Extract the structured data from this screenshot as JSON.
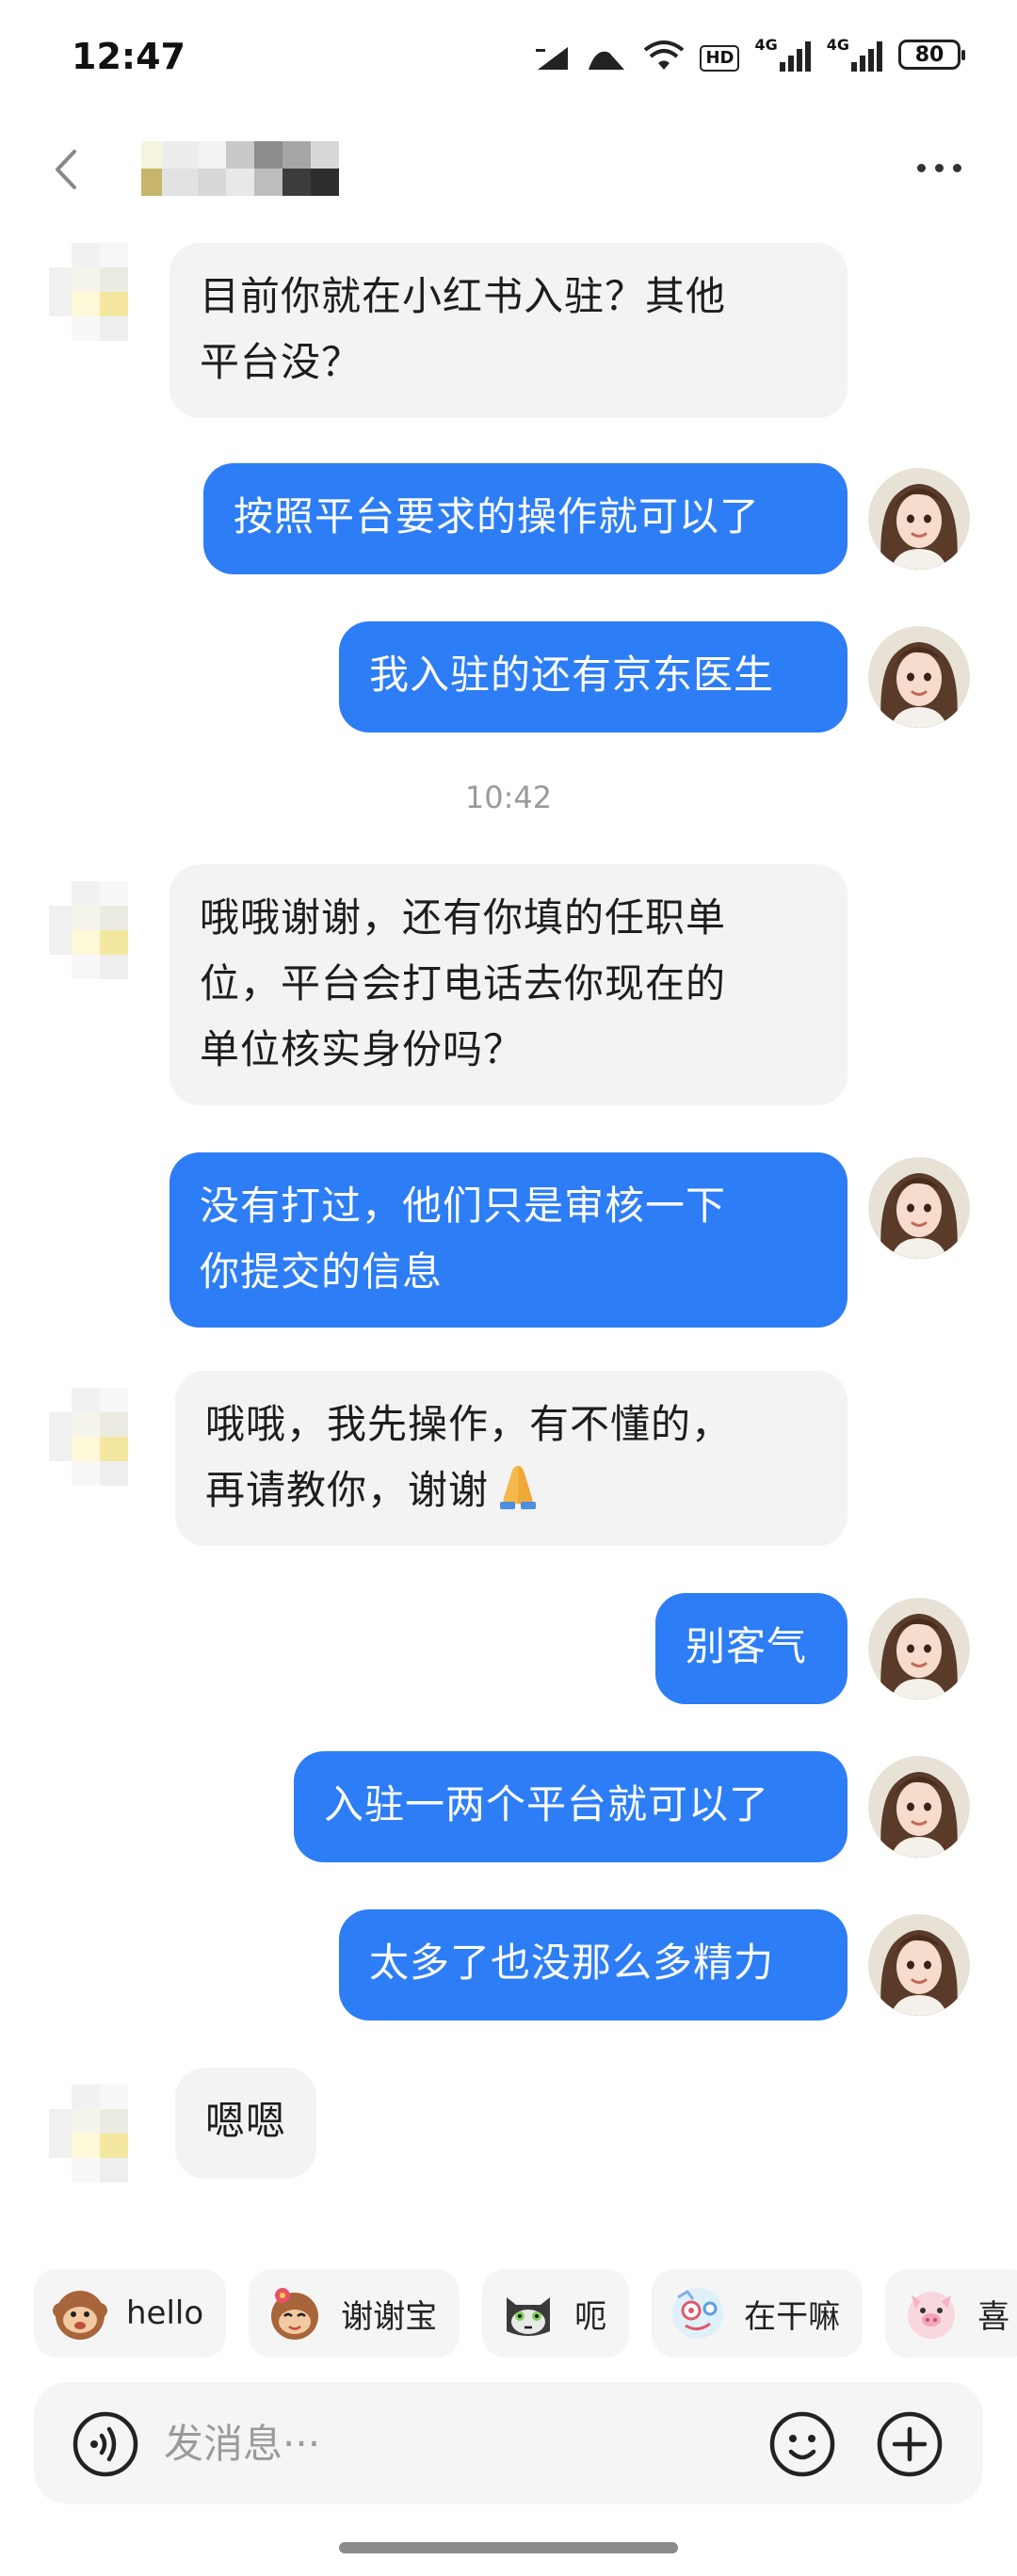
{
  "status_bar": {
    "time": "12:47",
    "network_hd": "HD",
    "network_1": "4G",
    "network_2": "4G",
    "battery": "80"
  },
  "header": {
    "back_icon": "chevron-left-icon",
    "more_icon": "more-horizontal-icon"
  },
  "messages": [
    {
      "side": "in",
      "text": "目前你就在小红书入驻？其他\n平台没？"
    },
    {
      "side": "out",
      "text": "按照平台要求的操作就可以了"
    },
    {
      "side": "out",
      "text": "我入驻的还有京东医生"
    },
    {
      "side": "in",
      "text": "哦哦谢谢，还有你填的任职单\n位，平台会打电话去你现在的\n单位核实身份吗？"
    },
    {
      "side": "out",
      "text": "没有打过，他们只是审核一下\n你提交的信息"
    },
    {
      "side": "in",
      "text": "哦哦，我先操作，有不懂的，\n再请教你，谢谢"
    },
    {
      "side": "out",
      "text": "别客气"
    },
    {
      "side": "out",
      "text": "入驻一两个平台就可以了"
    },
    {
      "side": "out",
      "text": "太多了也没那么多精力"
    },
    {
      "side": "in",
      "text": "嗯嗯"
    }
  ],
  "timestamp": "10:42",
  "quick_replies": [
    {
      "label": "hello",
      "icon": "monkey-sticker-icon"
    },
    {
      "label": "谢谢宝",
      "icon": "monkey-flower-sticker-icon"
    },
    {
      "label": "呃",
      "icon": "cat-sticker-icon"
    },
    {
      "label": "在干嘛",
      "icon": "character-sticker-icon"
    },
    {
      "label": "喜",
      "icon": "pig-sticker-icon"
    }
  ],
  "input": {
    "placeholder": "发消息···"
  },
  "colors": {
    "outgoing_bubble": "#2c7df6",
    "incoming_bubble": "#f3f3f3",
    "background": "#ffffff"
  }
}
